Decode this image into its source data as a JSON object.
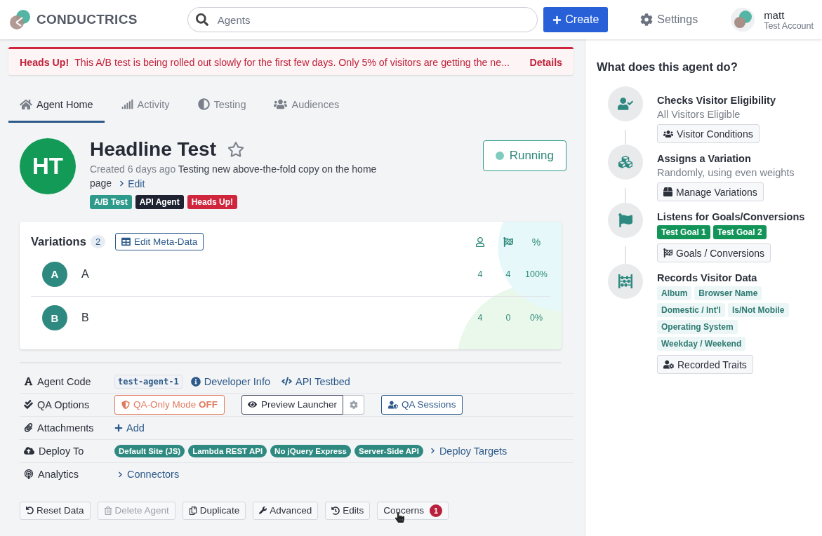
{
  "header": {
    "brand": "CONDUCTRICS",
    "search": {
      "placeholder": "Agents"
    },
    "create": "Create",
    "settings": "Settings",
    "user": {
      "name": "matt",
      "account": "Test Account"
    }
  },
  "alert": {
    "title": "Heads Up!",
    "message": "This A/B test is being rolled out slowly for the first few days. Only 5% of visitors are getting the ne...",
    "link": "Details"
  },
  "tabs": [
    {
      "kind": "home",
      "label": "Agent Home",
      "selected": true
    },
    {
      "kind": "activity",
      "label": "Activity",
      "selected": false
    },
    {
      "kind": "testing",
      "label": "Testing",
      "selected": false
    },
    {
      "kind": "audiences",
      "label": "Audiences",
      "selected": false
    }
  ],
  "agent": {
    "initials": "HT",
    "title": "Headline Test",
    "starred": false,
    "created": "Created 6 days ago",
    "description": "Testing new above-the-fold copy on the home page",
    "edit": "Edit",
    "status": "Running",
    "tags": [
      {
        "label": "A/B Test",
        "color": "#2e9a8c"
      },
      {
        "label": "API Agent",
        "color": "#1f2230"
      },
      {
        "label": "Heads Up!",
        "color": "#d0263d"
      }
    ]
  },
  "variations": {
    "title": "Variations",
    "count": "2",
    "edit_button": "Edit Meta-Data",
    "columns": [
      {
        "kind": "visitors"
      },
      {
        "kind": "goals"
      },
      {
        "kind": "text",
        "label": "%"
      }
    ],
    "rows": [
      {
        "initial": "A",
        "name": "A",
        "values": [
          "4",
          "4",
          "100%"
        ]
      },
      {
        "initial": "B",
        "name": "B",
        "values": [
          "4",
          "0",
          "0%"
        ]
      }
    ]
  },
  "details": [
    {
      "kind": "agent_code",
      "label": "Agent Code",
      "items": [
        {
          "kind": "code",
          "label": "test-agent-1"
        },
        {
          "kind": "info_link",
          "label": "Developer Info"
        },
        {
          "kind": "code_link",
          "label": "API Testbed"
        }
      ]
    },
    {
      "kind": "qa",
      "label": "QA Options",
      "items": [
        {
          "kind": "mode_toggle",
          "label": "QA-Only Mode **OFF**"
        },
        {
          "kind": "preview",
          "label": "Preview Launcher"
        },
        {
          "kind": "sessions",
          "label": "QA Sessions"
        }
      ]
    },
    {
      "kind": "attachments",
      "label": "Attachments",
      "items": [
        {
          "kind": "add",
          "label": "Add"
        }
      ]
    },
    {
      "kind": "deploy",
      "label": "Deploy To",
      "items": [
        {
          "kind": "tag",
          "label": "Default Site (JS)"
        },
        {
          "kind": "tag",
          "label": "Lambda REST API"
        },
        {
          "kind": "tag",
          "label": "No jQuery Express"
        },
        {
          "kind": "tag",
          "label": "Server-Side API"
        },
        {
          "kind": "chevron_link",
          "label": "Deploy Targets"
        }
      ]
    },
    {
      "kind": "analytics",
      "label": "Analytics",
      "items": [
        {
          "kind": "chevron_link",
          "label": "Connectors"
        }
      ]
    }
  ],
  "actions": [
    {
      "kind": "reset",
      "label": "Reset Data",
      "disabled": false
    },
    {
      "kind": "delete",
      "label": "Delete Agent",
      "disabled": true
    },
    {
      "kind": "duplicate",
      "label": "Duplicate",
      "disabled": false
    },
    {
      "kind": "advanced",
      "label": "Advanced",
      "disabled": false
    },
    {
      "kind": "edits",
      "label": "Edits",
      "disabled": false
    },
    {
      "kind": "concerns",
      "label": "Concerns",
      "disabled": false,
      "badge": "1"
    }
  ],
  "panel": {
    "title": "What does this agent do?",
    "steps": [
      {
        "kind": "eligibility",
        "title": "Checks Visitor Eligibility",
        "subtitle": "All Visitors Eligible",
        "button": "Visitor Conditions"
      },
      {
        "kind": "assign",
        "title": "Assigns a Variation",
        "subtitle": "Randomly, using even weights",
        "button": "Manage Variations"
      },
      {
        "kind": "goals",
        "title": "Listens for Goals/Conversions",
        "tags": [
          {
            "label": "Test Goal 1",
            "kind": "solid"
          },
          {
            "label": "Test Goal 2",
            "kind": "solid"
          }
        ],
        "button": "Goals / Conversions"
      },
      {
        "kind": "records",
        "title": "Records Visitor Data",
        "tags": [
          {
            "label": "Album",
            "kind": "soft"
          },
          {
            "label": "Browser Name",
            "kind": "soft"
          },
          {
            "label": "Domestic / Int'l",
            "kind": "soft"
          },
          {
            "label": "Is/Not Mobile",
            "kind": "soft"
          },
          {
            "label": "Operating System",
            "kind": "soft"
          },
          {
            "label": "Weekday / Weekend",
            "kind": "soft"
          }
        ],
        "button": "Recorded Traits"
      }
    ]
  }
}
